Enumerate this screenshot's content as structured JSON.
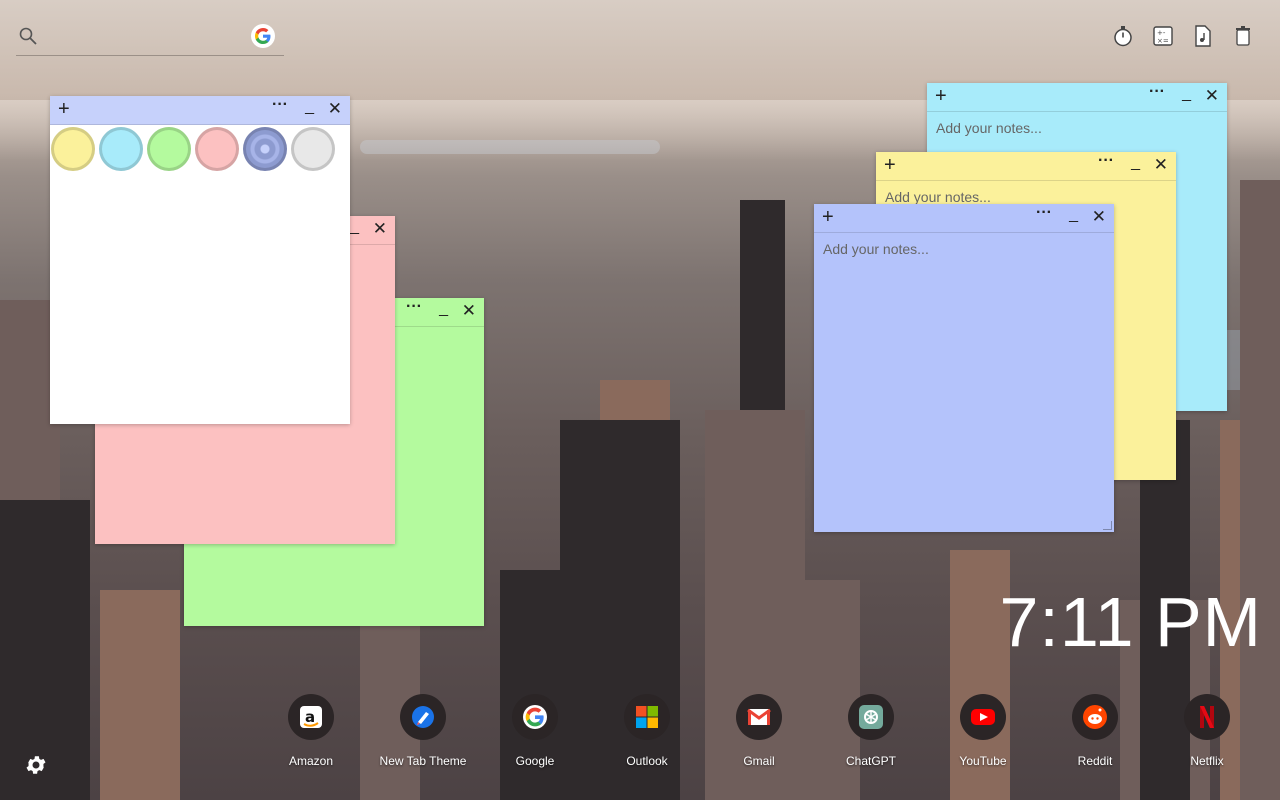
{
  "search": {
    "placeholder": ""
  },
  "toolbar": {
    "icons": [
      "timer-icon",
      "calculator-icon",
      "music-file-icon",
      "trash-icon"
    ]
  },
  "notes": [
    {
      "id": "blue",
      "color": "#a8ebfa",
      "placeholder": "Add your notes..."
    },
    {
      "id": "yellow",
      "color": "#fbf19b",
      "placeholder": "Add your notes..."
    },
    {
      "id": "periwinkle",
      "color": "#b4c3fb",
      "placeholder": "Add your notes..."
    },
    {
      "id": "pink",
      "color": "#fcc1c1",
      "placeholder": ""
    },
    {
      "id": "green",
      "color": "#b4fa9e",
      "placeholder": ""
    },
    {
      "id": "white",
      "color": "#ffffff",
      "header_color": "#c6d1fb",
      "placeholder": ""
    }
  ],
  "note_controls": {
    "add": "+",
    "more": "···",
    "minimize": "_",
    "close": "✕"
  },
  "swatches": [
    "#fbf19b",
    "#a8ebfa",
    "#b4fa9e",
    "#fcc1c1",
    "#8d9bd0",
    "#e8e8e8"
  ],
  "clock": {
    "time": "7:11 PM"
  },
  "shortcuts": [
    {
      "label": "Amazon",
      "icon": "amazon-icon"
    },
    {
      "label": "New Tab Theme",
      "icon": "new-tab-theme-icon"
    },
    {
      "label": "Google",
      "icon": "google-icon"
    },
    {
      "label": "Outlook",
      "icon": "outlook-icon"
    },
    {
      "label": "Gmail",
      "icon": "gmail-icon"
    },
    {
      "label": "ChatGPT",
      "icon": "chatgpt-icon"
    },
    {
      "label": "YouTube",
      "icon": "youtube-icon"
    },
    {
      "label": "Reddit",
      "icon": "reddit-icon"
    },
    {
      "label": "Netflix",
      "icon": "netflix-icon"
    }
  ]
}
